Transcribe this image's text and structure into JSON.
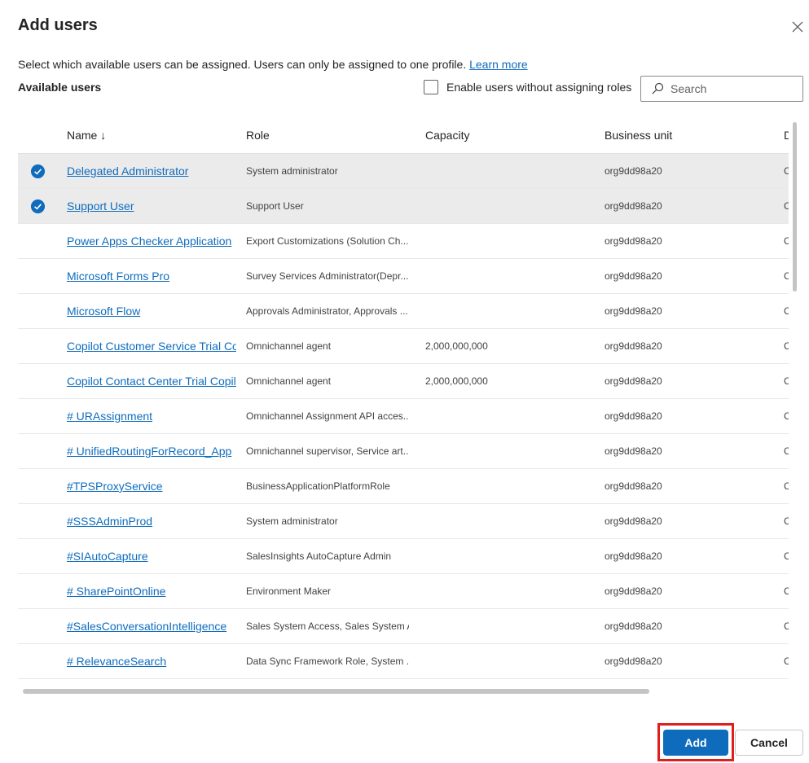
{
  "dialog": {
    "title": "Add users",
    "description": "Select which available users can be assigned. Users can only be assigned to one profile.",
    "learn_more": "Learn more",
    "available_label": "Available users",
    "enable_label": "Enable users without assigning roles",
    "search_placeholder": "Search",
    "add_label": "Add",
    "cancel_label": "Cancel"
  },
  "columns": {
    "name": "Name ↓",
    "role": "Role",
    "capacity": "Capacity",
    "business_unit": "Business unit",
    "d": "D"
  },
  "rows": [
    {
      "name": "Delegated Administrator",
      "role": "System administrator",
      "capacity": "",
      "bu": "org9dd98a20",
      "d": "C",
      "selected": true
    },
    {
      "name": "Support User",
      "role": "Support User",
      "capacity": "",
      "bu": "org9dd98a20",
      "d": "C",
      "selected": true
    },
    {
      "name": "Power Apps Checker Application",
      "role": "Export Customizations (Solution Ch...",
      "capacity": "",
      "bu": "org9dd98a20",
      "d": "C",
      "selected": false
    },
    {
      "name": "Microsoft Forms Pro",
      "role": "Survey Services Administrator(Depr...",
      "capacity": "",
      "bu": "org9dd98a20",
      "d": "C",
      "selected": false
    },
    {
      "name": "Microsoft Flow",
      "role": "Approvals Administrator, Approvals ...",
      "capacity": "",
      "bu": "org9dd98a20",
      "d": "C",
      "selected": false
    },
    {
      "name": "Copilot Customer Service Trial Copilot",
      "role": "Omnichannel agent",
      "capacity": "2,000,000,000",
      "bu": "org9dd98a20",
      "d": "C",
      "selected": false
    },
    {
      "name": "Copilot Contact Center Trial Copilot",
      "role": "Omnichannel agent",
      "capacity": "2,000,000,000",
      "bu": "org9dd98a20",
      "d": "C",
      "selected": false
    },
    {
      "name": "# URAssignment",
      "role": "Omnichannel Assignment API acces...",
      "capacity": "",
      "bu": "org9dd98a20",
      "d": "C",
      "selected": false
    },
    {
      "name": "# UnifiedRoutingForRecord_App",
      "role": "Omnichannel supervisor, Service art...",
      "capacity": "",
      "bu": "org9dd98a20",
      "d": "C",
      "selected": false
    },
    {
      "name": "#TPSProxyService",
      "role": "BusinessApplicationPlatformRole",
      "capacity": "",
      "bu": "org9dd98a20",
      "d": "C",
      "selected": false
    },
    {
      "name": "#SSSAdminProd",
      "role": "System administrator",
      "capacity": "",
      "bu": "org9dd98a20",
      "d": "C",
      "selected": false
    },
    {
      "name": "#SIAutoCapture",
      "role": "SalesInsights AutoCapture Admin",
      "capacity": "",
      "bu": "org9dd98a20",
      "d": "C",
      "selected": false
    },
    {
      "name": "# SharePointOnline",
      "role": "Environment Maker",
      "capacity": "",
      "bu": "org9dd98a20",
      "d": "C",
      "selected": false
    },
    {
      "name": "#SalesConversationIntelligence",
      "role": "Sales System Access, Sales System A...",
      "capacity": "",
      "bu": "org9dd98a20",
      "d": "C",
      "selected": false
    },
    {
      "name": "# RelevanceSearch",
      "role": "Data Sync Framework Role, System ...",
      "capacity": "",
      "bu": "org9dd98a20",
      "d": "C",
      "selected": false
    }
  ]
}
